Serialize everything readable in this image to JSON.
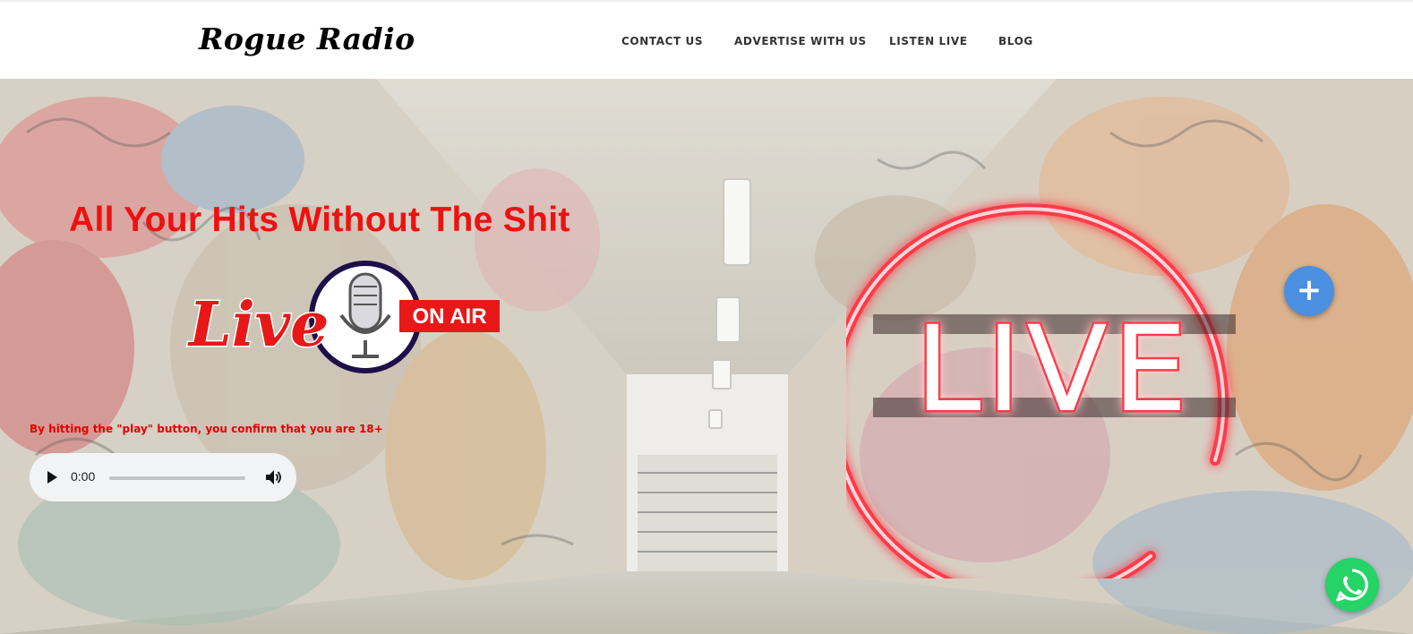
{
  "header": {
    "logo_text": "Rogue Radio",
    "nav": [
      {
        "label": "CONTACT US"
      },
      {
        "label": "ADVERTISE WITH US"
      },
      {
        "label": "LISTEN LIVE"
      },
      {
        "label": "BLOG"
      }
    ]
  },
  "hero": {
    "headline": "All Your Hits Without The Shit",
    "badge": {
      "live_text": "Live",
      "on_air_text": "ON AIR"
    },
    "disclaimer": "By hitting the \"play\" button, you confirm that you are 18+",
    "player": {
      "time": "0:00",
      "progress": 0
    },
    "neon_sign_text": "LIVE",
    "fab_plus_label": "+"
  },
  "colors": {
    "accent_red": "#ee1111",
    "neon_pink": "#ff3a4a",
    "fab_blue": "#4a8fe0",
    "whatsapp_green": "#25d366"
  },
  "icons": {
    "play": "play-icon",
    "volume": "volume-icon",
    "microphone": "microphone-icon",
    "plus": "plus-icon",
    "whatsapp": "whatsapp-icon"
  }
}
